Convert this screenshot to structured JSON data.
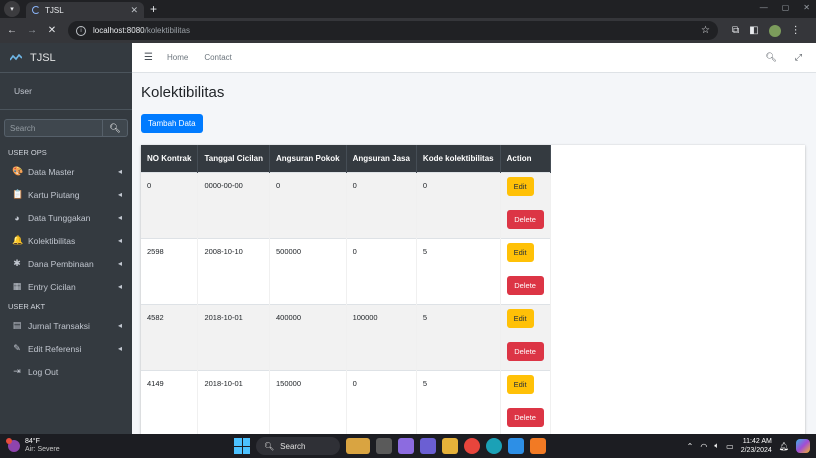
{
  "browser": {
    "tab_title": "TJSL",
    "new_tab_label": "+",
    "url_host": "localhost:8080",
    "url_path": "/kolektibilitas"
  },
  "sidebar": {
    "brand": "TJSL",
    "user": "User",
    "search_placeholder": "Search",
    "sections": [
      {
        "header": "USER OPS",
        "items": [
          {
            "label": "Data Master",
            "icon": "palette-icon",
            "glyph": "🎨",
            "has_arrow": true
          },
          {
            "label": "Kartu Piutang",
            "icon": "copy-icon",
            "glyph": "📋",
            "has_arrow": true
          },
          {
            "label": "Data Tunggakan",
            "icon": "chart-pie-icon",
            "glyph": "◕",
            "has_arrow": true
          },
          {
            "label": "Kolektibilitas",
            "icon": "bell-icon",
            "glyph": "🔔",
            "has_arrow": true
          },
          {
            "label": "Dana Pembinaan",
            "icon": "asterisk-icon",
            "glyph": "✱",
            "has_arrow": true
          },
          {
            "label": "Entry Cicilan",
            "icon": "table-icon",
            "glyph": "▦",
            "has_arrow": true
          }
        ]
      },
      {
        "header": "USER AKT",
        "items": [
          {
            "label": "Jurnal Transaksi",
            "icon": "book-icon",
            "glyph": "▤",
            "has_arrow": true
          },
          {
            "label": "Edit Referensi",
            "icon": "edit-icon",
            "glyph": "✎",
            "has_arrow": true
          },
          {
            "label": "Log Out",
            "icon": "sign-out-icon",
            "glyph": "⇥",
            "has_arrow": false
          }
        ]
      }
    ]
  },
  "topnav": {
    "home": "Home",
    "contact": "Contact"
  },
  "main": {
    "title": "Kolektibilitas",
    "add_button": "Tambah Data",
    "table": {
      "columns": [
        "NO Kontrak",
        "Tanggal Cicilan",
        "Angsuran Pokok",
        "Angsuran Jasa",
        "Kode kolektibilitas",
        "Action"
      ],
      "edit_label": "Edit",
      "delete_label": "Delete",
      "rows": [
        [
          "0",
          "0000-00-00",
          "0",
          "0",
          "0"
        ],
        [
          "2598",
          "2008-10-10",
          "500000",
          "0",
          "5"
        ],
        [
          "4582",
          "2018-10-01",
          "400000",
          "100000",
          "5"
        ],
        [
          "4149",
          "2018-10-01",
          "150000",
          "0",
          "5"
        ]
      ]
    }
  },
  "taskbar": {
    "weather_temp": "84°F",
    "weather_desc": "Air: Severe",
    "search_label": "Search",
    "time": "11:42 AM",
    "date": "2/23/2024"
  }
}
